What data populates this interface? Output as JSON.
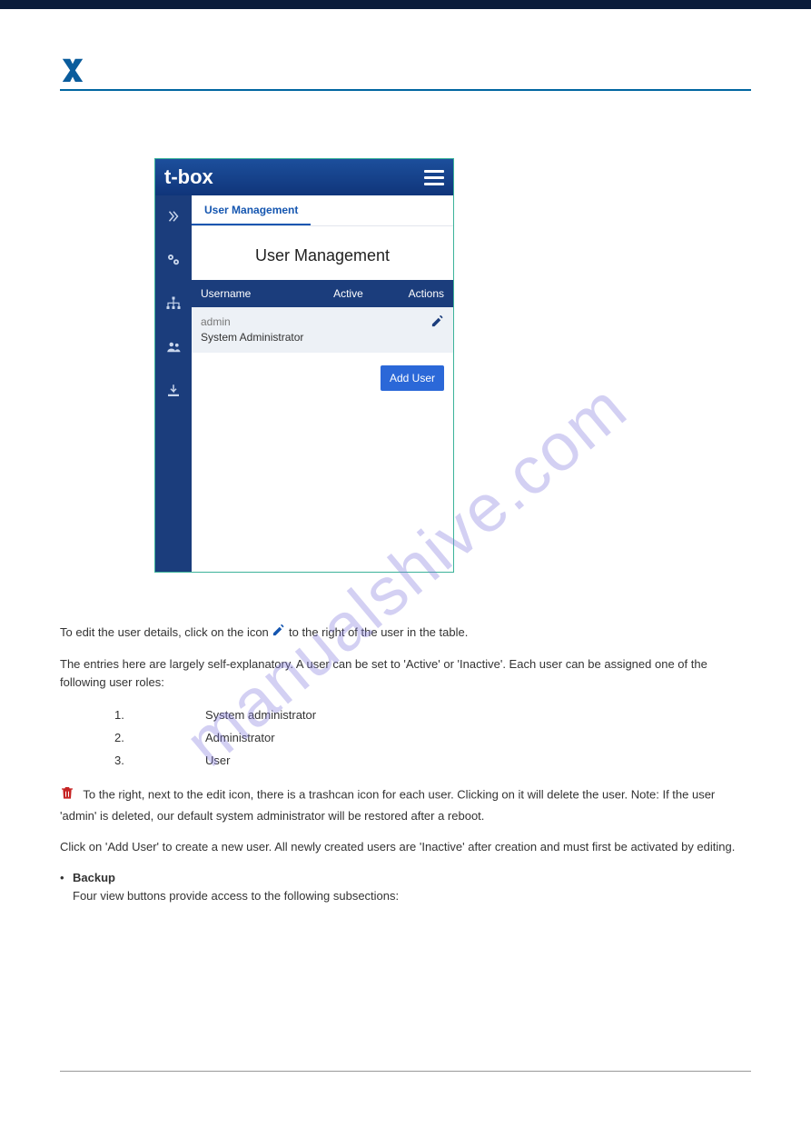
{
  "watermark": "manualshive.com",
  "screenshot": {
    "brand": "t-box",
    "tab_label": "User Management",
    "page_title": "User Management",
    "table": {
      "headers": {
        "username": "Username",
        "active": "Active",
        "actions": "Actions"
      },
      "row": {
        "username": "admin",
        "role": "System Administrator"
      }
    },
    "add_user_label": "Add User"
  },
  "doc": {
    "p1": "To edit the user details, click on the icon ",
    "p1_end": " to the right of the user in the table.",
    "p2": "The entries here are largely self-explanatory. A user can be set to 'Active' or 'Inactive'. Each user can be assigned one of the following user roles:",
    "roles": [
      {
        "num": "1.",
        "label": "System administrator"
      },
      {
        "num": "2.",
        "label": "Administrator"
      },
      {
        "num": "3.",
        "label": "User"
      }
    ],
    "p3_pre": "",
    "p3": " To the right, next to the edit icon, there is a trashcan icon for each user. Clicking on it will delete the user. Note: If the user 'admin' is deleted, our default system administrator will be restored after a reboot.",
    "p4": "Click on 'Add User' to create a new user. All newly created users are 'Inactive' after creation and must first be activated by editing.",
    "bullet_label": "Backup",
    "bullet_text": " Four view buttons provide access to the following subsections:"
  }
}
